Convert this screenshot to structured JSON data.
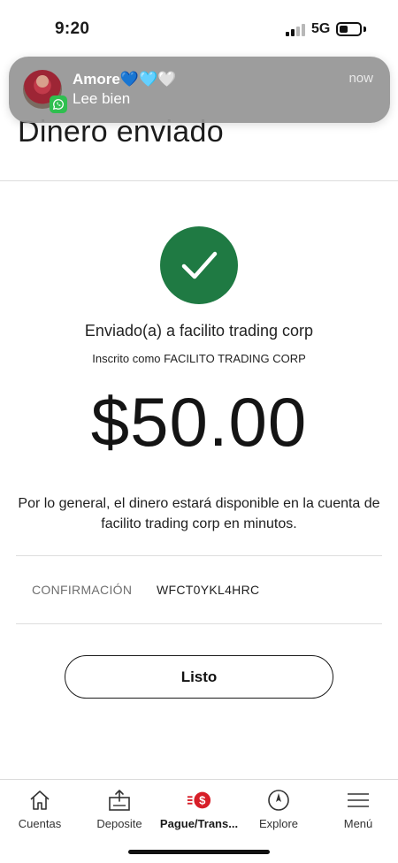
{
  "status_bar": {
    "time": "9:20",
    "network": "5G",
    "signal_bars": 2,
    "signal_bars_total": 4,
    "battery_level": 0.3
  },
  "notification": {
    "app_icon": "whatsapp-icon",
    "sender": "Amore💙🩵🤍",
    "message": "Lee bien",
    "time": "now"
  },
  "page": {
    "title": "Dinero enviado"
  },
  "confirmation": {
    "status_icon": "check-circle-icon",
    "status_color": "#1f7a43",
    "sent_to": "Enviado(a) a facilito trading corp",
    "enrolled_as": "Inscrito como FACILITO TRADING CORP",
    "amount": "$50.00",
    "availability_text": "Por lo general, el dinero estará disponible en la cuenta de facilito trading corp en minutos.",
    "confirmation_label": "CONFIRMACIÓN",
    "confirmation_code": "WFCT0YKL4HRC",
    "done_label": "Listo"
  },
  "bottom_nav": {
    "active_color": "#d71e28",
    "items": [
      {
        "label": "Cuentas",
        "icon": "home-icon"
      },
      {
        "label": "Deposite",
        "icon": "deposit-icon"
      },
      {
        "label": "Pague/Trans...",
        "icon": "pay-transfer-icon",
        "active": true
      },
      {
        "label": "Explore",
        "icon": "compass-icon"
      },
      {
        "label": "Menú",
        "icon": "hamburger-menu-icon"
      }
    ]
  }
}
